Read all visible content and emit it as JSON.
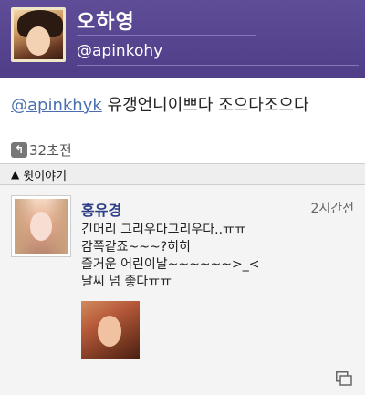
{
  "profile": {
    "name": "오하영",
    "handle": "@apinkohy"
  },
  "tweet": {
    "mention": "@apinkhyk",
    "text": " 유갱언니이쁘다 조으다조으다",
    "retweet_icon": "retweet-icon",
    "retweet_text": "32초전"
  },
  "thread": {
    "arrow": "▲",
    "label": "윗이야기"
  },
  "reply": {
    "name": "홍유경",
    "time": "2시간전",
    "lines": [
      "긴머리 그리우다그리우다..ㅠㅠ",
      "감쪽같죠~~~?히히",
      "즐거운 어린이날~~~~~~>_<",
      "날씨 넘 좋다ㅠㅠ"
    ],
    "gallery_icon": "gallery-icon"
  }
}
